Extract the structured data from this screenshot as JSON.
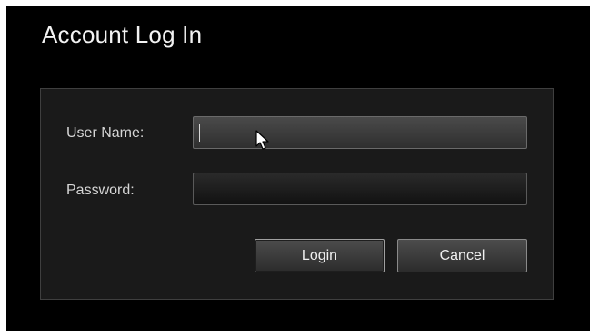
{
  "dialog": {
    "title": "Account Log In"
  },
  "form": {
    "username_label": "User Name:",
    "username_value": "",
    "password_label": "Password:",
    "password_value": ""
  },
  "buttons": {
    "login_label": "Login",
    "cancel_label": "Cancel"
  },
  "colors": {
    "background": "#000000",
    "panel": "#1a1a1a",
    "text": "#d6d6d6"
  },
  "icons": {
    "pointer": "mouse-pointer-icon"
  }
}
